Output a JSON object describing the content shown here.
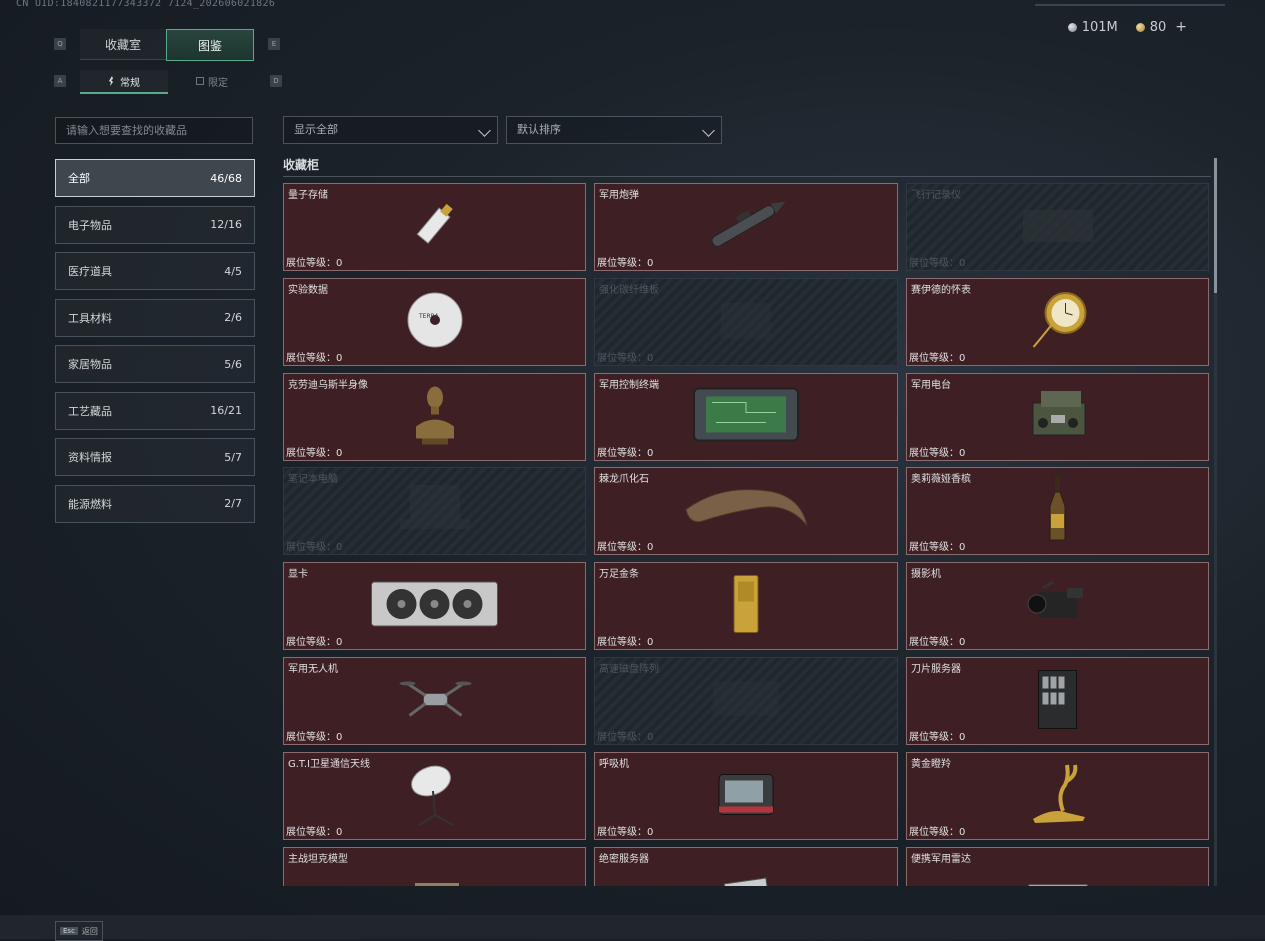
{
  "uid": "CN UID:1840821177343372 7124_202606021826",
  "currency": {
    "silver": "101M",
    "gold": "80",
    "plus": "+"
  },
  "keys": {
    "q": "Q",
    "e": "E",
    "a": "A",
    "d": "D"
  },
  "tabs": [
    {
      "label": "收藏室",
      "active": false
    },
    {
      "label": "图鉴",
      "active": true
    }
  ],
  "subtabs": [
    {
      "label": "常规",
      "active": true
    },
    {
      "label": "限定",
      "active": false
    }
  ],
  "search": {
    "placeholder": "请输入想要查找的收藏品"
  },
  "categories": [
    {
      "name": "全部",
      "count": "46/68",
      "active": true
    },
    {
      "name": "电子物品",
      "count": "12/16"
    },
    {
      "name": "医疗道具",
      "count": "4/5"
    },
    {
      "name": "工具材料",
      "count": "2/6"
    },
    {
      "name": "家居物品",
      "count": "5/6"
    },
    {
      "name": "工艺藏品",
      "count": "16/21"
    },
    {
      "name": "资料情报",
      "count": "5/7"
    },
    {
      "name": "能源燃料",
      "count": "2/7"
    }
  ],
  "filters": {
    "show": "显示全部",
    "sort": "默认排序"
  },
  "section_title": "收藏柜",
  "level_label": "展位等级：",
  "items": [
    {
      "name": "量子存储",
      "level": "0",
      "locked": false,
      "icon": "usb-drive-icon"
    },
    {
      "name": "军用炮弹",
      "level": "0",
      "locked": false,
      "icon": "artillery-shell-icon"
    },
    {
      "name": "飞行记录仪",
      "level": "0",
      "locked": true,
      "icon": "flight-recorder-icon"
    },
    {
      "name": "实验数据",
      "level": "0",
      "locked": false,
      "icon": "disc-icon"
    },
    {
      "name": "强化碳纤维板",
      "level": "0",
      "locked": true,
      "icon": "carbon-plate-icon"
    },
    {
      "name": "赛伊德的怀表",
      "level": "0",
      "locked": false,
      "icon": "pocket-watch-icon"
    },
    {
      "name": "克劳迪乌斯半身像",
      "level": "0",
      "locked": false,
      "icon": "bust-icon"
    },
    {
      "name": "军用控制终端",
      "level": "0",
      "locked": false,
      "icon": "control-terminal-icon"
    },
    {
      "name": "军用电台",
      "level": "0",
      "locked": false,
      "icon": "radio-icon"
    },
    {
      "name": "笔记本电脑",
      "level": "0",
      "locked": true,
      "icon": "laptop-icon"
    },
    {
      "name": "棘龙爪化石",
      "level": "0",
      "locked": false,
      "icon": "claw-fossil-icon"
    },
    {
      "name": "奥莉薇娅香槟",
      "level": "0",
      "locked": false,
      "icon": "champagne-icon"
    },
    {
      "name": "显卡",
      "level": "0",
      "locked": false,
      "icon": "gpu-icon"
    },
    {
      "name": "万足金条",
      "level": "0",
      "locked": false,
      "icon": "gold-bar-icon"
    },
    {
      "name": "摄影机",
      "level": "0",
      "locked": false,
      "icon": "camera-icon"
    },
    {
      "name": "军用无人机",
      "level": "0",
      "locked": false,
      "icon": "drone-icon"
    },
    {
      "name": "高速磁盘阵列",
      "level": "0",
      "locked": true,
      "icon": "disk-array-icon"
    },
    {
      "name": "刀片服务器",
      "level": "0",
      "locked": false,
      "icon": "blade-server-icon"
    },
    {
      "name": "G.T.I卫星通信天线",
      "level": "0",
      "locked": false,
      "icon": "satellite-dish-icon"
    },
    {
      "name": "呼吸机",
      "level": "0",
      "locked": false,
      "icon": "ventilator-icon"
    },
    {
      "name": "黄金瞪羚",
      "level": "0",
      "locked": false,
      "icon": "gold-gazelle-icon"
    },
    {
      "name": "主战坦克模型",
      "level": "",
      "locked": false,
      "icon": "tank-model-icon"
    },
    {
      "name": "绝密服务器",
      "level": "",
      "locked": false,
      "icon": "secret-server-icon"
    },
    {
      "name": "便携军用雷达",
      "level": "",
      "locked": false,
      "icon": "radar-icon"
    }
  ],
  "footer": {
    "esc_key": "Esc",
    "back": "返回"
  }
}
